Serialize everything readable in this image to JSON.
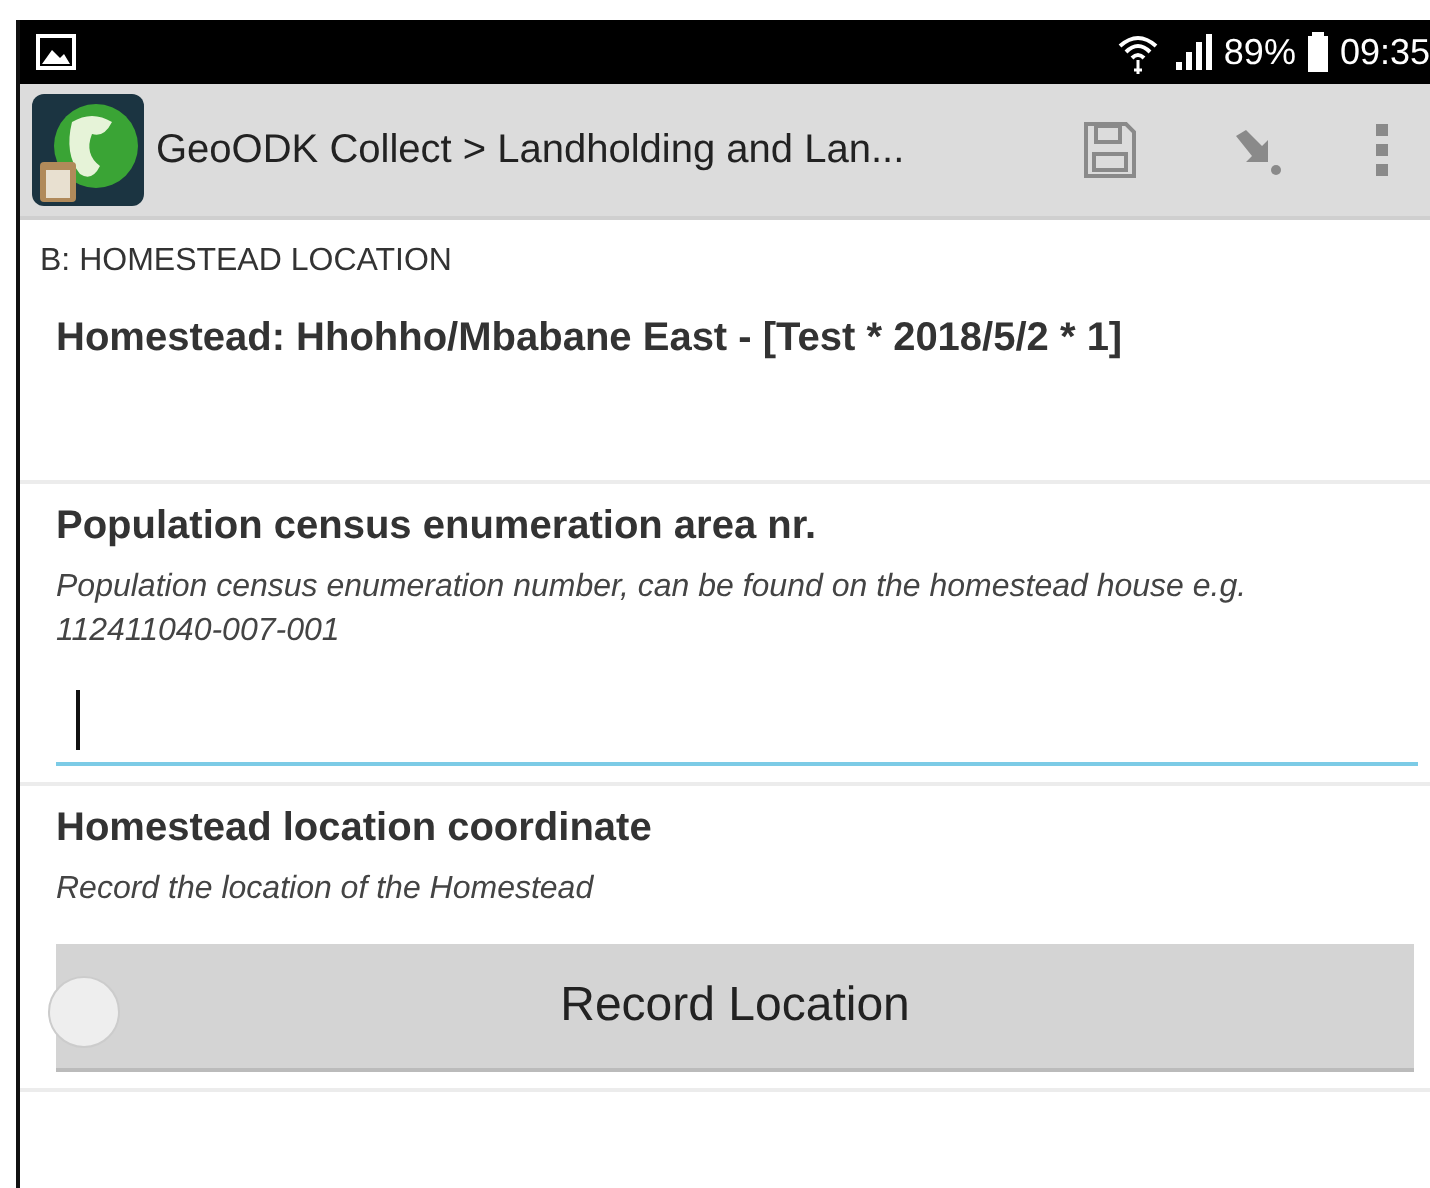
{
  "status_bar": {
    "battery": "89%",
    "time": "09:35"
  },
  "app_bar": {
    "title": "GeoODK Collect > Landholding and Lan..."
  },
  "section": "B: HOMESTEAD LOCATION",
  "heading": "Homestead: Hhohho/Mbabane East - [Test * 2018/5/2 * 1]",
  "questions": [
    {
      "kind": "text",
      "label": "Population census enumeration area nr.",
      "hint": "Population census enumeration number, can be found on the homestead house e.g. 112411040-007-001",
      "focused": true
    },
    {
      "kind": "location",
      "label": "Homestead location coordinate",
      "hint": "Record the location of the Homestead",
      "button": "Record Location"
    }
  ]
}
